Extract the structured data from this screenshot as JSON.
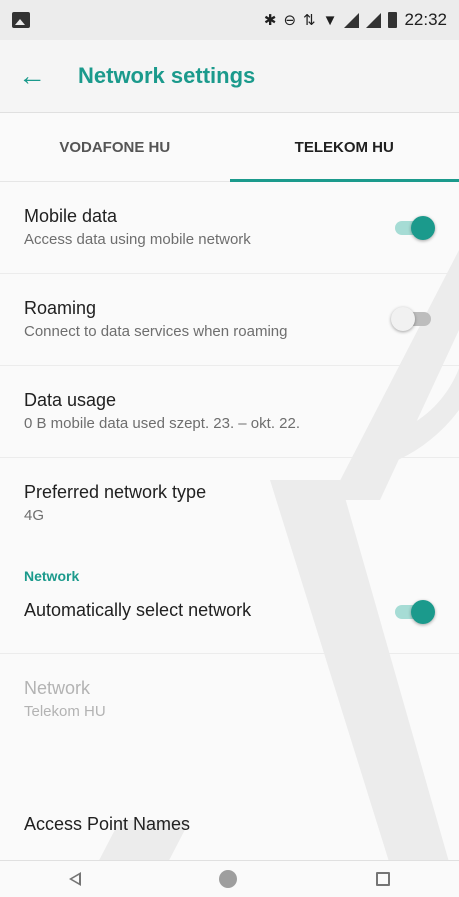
{
  "status_bar": {
    "time": "22:32",
    "icons": [
      "gallery-icon",
      "bluetooth-icon",
      "dnd-icon",
      "data-arrows-icon",
      "wifi-icon",
      "signal-icon",
      "signal-icon",
      "battery-icon"
    ]
  },
  "app_bar": {
    "title": "Network settings",
    "back_icon": "arrow-back-icon"
  },
  "tabs": [
    {
      "label": "VODAFONE HU",
      "selected": false
    },
    {
      "label": "TELEKOM HU",
      "selected": true
    }
  ],
  "settings": {
    "mobile_data": {
      "title": "Mobile data",
      "summary": "Access data using mobile network",
      "enabled": true
    },
    "roaming": {
      "title": "Roaming",
      "summary": "Connect to data services when roaming",
      "enabled": false
    },
    "data_usage": {
      "title": "Data usage",
      "summary": "0 B mobile data used szept. 23. – okt. 22."
    },
    "preferred_network_type": {
      "title": "Preferred network type",
      "summary": "4G"
    },
    "network_section": {
      "header": "Network"
    },
    "auto_select": {
      "title": "Automatically select network",
      "enabled": true
    },
    "network": {
      "title": "Network",
      "summary": "Telekom HU",
      "disabled": true
    },
    "apn": {
      "title": "Access Point Names"
    }
  },
  "colors": {
    "accent": "#1b9a8c",
    "switch_on_track": "#a6dcd5",
    "switch_off_track": "#bdbdbd"
  }
}
